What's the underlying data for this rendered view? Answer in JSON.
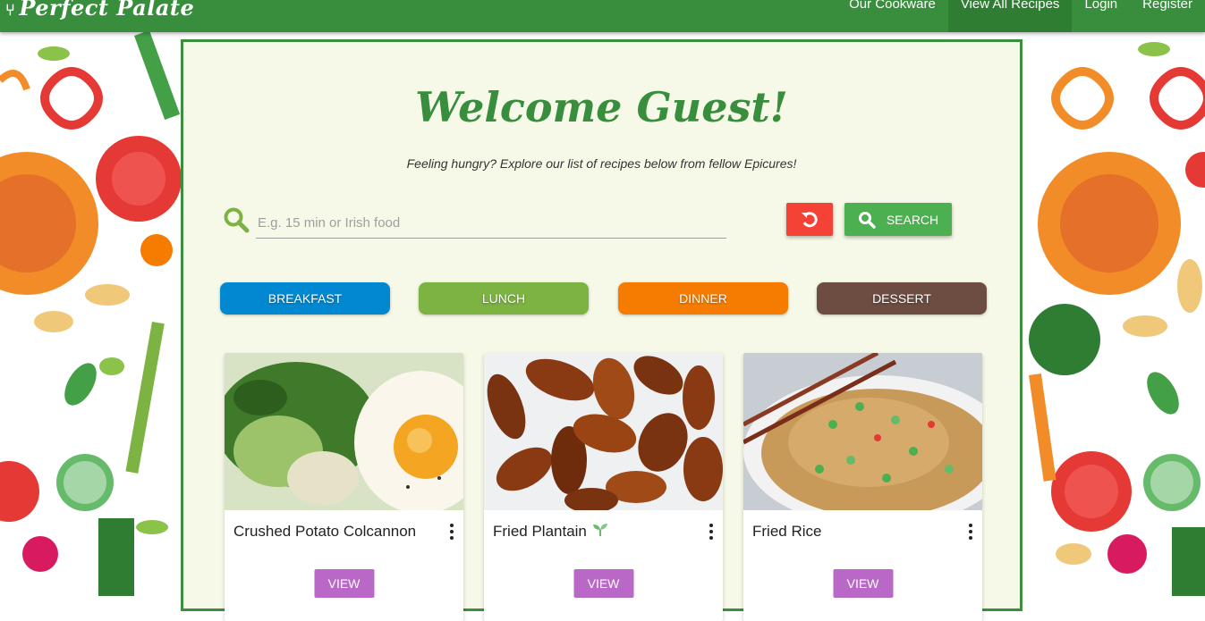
{
  "brand": {
    "name": "Perfect Palate",
    "icon": "fork-icon"
  },
  "nav": {
    "links": [
      {
        "label": "Our Cookware",
        "active": false
      },
      {
        "label": "View All Recipes",
        "active": true
      },
      {
        "label": "Login",
        "active": false
      },
      {
        "label": "Register",
        "active": false
      }
    ]
  },
  "hero": {
    "welcome": "Welcome Guest!",
    "tagline": "Feeling hungry? Explore our list of recipes below from fellow Epicures!"
  },
  "search": {
    "placeholder": "E.g. 15 min or Irish food",
    "value": "",
    "reset_icon": "undo-icon",
    "button_label": "Search",
    "icon": "search-icon"
  },
  "categories": [
    {
      "label": "Breakfast",
      "color": "#0288d1"
    },
    {
      "label": "Lunch",
      "color": "#7cb342"
    },
    {
      "label": "Dinner",
      "color": "#f57c00"
    },
    {
      "label": "Dessert",
      "color": "#6d4c41"
    }
  ],
  "recipes": [
    {
      "title": "Crushed Potato Colcannon",
      "vegetarian": false,
      "view_label": "View"
    },
    {
      "title": "Fried Plantain",
      "vegetarian": true,
      "view_label": "View"
    },
    {
      "title": "Fried Rice",
      "vegetarian": false,
      "view_label": "View"
    }
  ],
  "colors": {
    "nav": "#388e3c",
    "panel": "#f7f9e8",
    "accent_green": "#4caf50",
    "reset_red": "#f44336",
    "view_purple": "#ba68c8"
  }
}
